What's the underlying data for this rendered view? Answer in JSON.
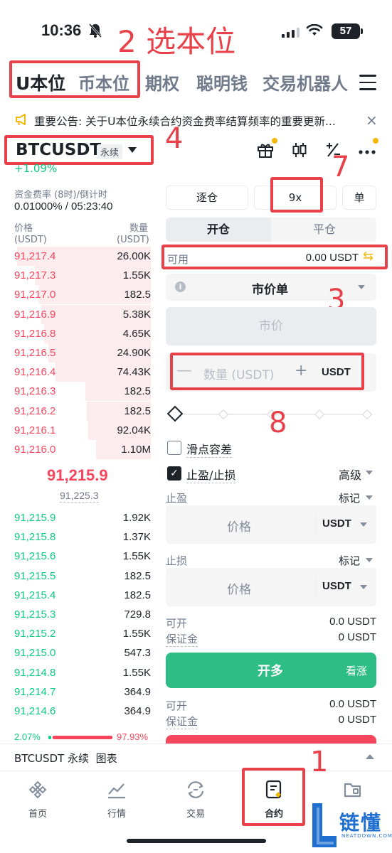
{
  "status": {
    "time": "10:36",
    "battery": "57"
  },
  "annotations": {
    "n1": "1",
    "n2": "2 选本位",
    "n3": "3",
    "n4": "4",
    "n7": "7",
    "n8": "8"
  },
  "top_tabs": {
    "u": "U本位",
    "coin": "币本位",
    "options": "期权",
    "smart": "聪明钱",
    "bot": "交易机器人"
  },
  "notice": {
    "text": "重要公告: 关于U本位永续合约资金费率结算频率的重要更新...",
    "close": "×"
  },
  "symbol": {
    "name": "BTCUSDT",
    "tag": "永续",
    "change": "+1.09%"
  },
  "funding": {
    "label": "资金费率 (8时)/倒计时",
    "value": "0.01000% / 05:23:40"
  },
  "orderbook": {
    "price_header": "价格",
    "price_unit": "(USDT)",
    "qty_header": "数量",
    "qty_unit": "(USDT)",
    "asks": [
      {
        "price": "91,217.4",
        "qty": "26.00K",
        "depth": 0.98
      },
      {
        "price": "91,217.3",
        "qty": "1.55K",
        "depth": 0.85
      },
      {
        "price": "91,217.0",
        "qty": "182.5",
        "depth": 0.82
      },
      {
        "price": "91,216.9",
        "qty": "5.38K",
        "depth": 0.8
      },
      {
        "price": "91,216.8",
        "qty": "4.65K",
        "depth": 0.78
      },
      {
        "price": "91,216.5",
        "qty": "24.90K",
        "depth": 0.75
      },
      {
        "price": "91,216.4",
        "qty": "74.43K",
        "depth": 0.7
      },
      {
        "price": "91,216.3",
        "qty": "182.5",
        "depth": 0.48
      },
      {
        "price": "91,216.2",
        "qty": "182.5",
        "depth": 0.47
      },
      {
        "price": "91,216.1",
        "qty": "92.04K",
        "depth": 0.46
      },
      {
        "price": "91,216.0",
        "qty": "1.10M",
        "depth": 0.4
      }
    ],
    "mid_price": "91,215.9",
    "mark_price": "91,225.3",
    "bids": [
      {
        "price": "91,215.9",
        "qty": "1.92K"
      },
      {
        "price": "91,215.8",
        "qty": "1.37K"
      },
      {
        "price": "91,215.6",
        "qty": "1.55K"
      },
      {
        "price": "91,215.5",
        "qty": "182.5"
      },
      {
        "price": "91,215.4",
        "qty": "182.5"
      },
      {
        "price": "91,215.3",
        "qty": "729.8"
      },
      {
        "price": "91,215.2",
        "qty": "1.55K"
      },
      {
        "price": "91,215.0",
        "qty": "547.3"
      },
      {
        "price": "91,214.8",
        "qty": "1.55K"
      },
      {
        "price": "91,214.7",
        "qty": "364.9"
      },
      {
        "price": "91,214.6",
        "qty": "364.9"
      }
    ],
    "buy_ratio": "2.07%",
    "sell_ratio": "97.93%"
  },
  "trade": {
    "margin_mode": "逐仓",
    "leverage": "9x",
    "position_mode": "单",
    "open_tab": "开仓",
    "close_tab": "平仓",
    "available_label": "可用",
    "available_value": "0.00 USDT",
    "order_type": "市价单",
    "price_placeholder": "市价",
    "qty_minus": "—",
    "qty_placeholder": "数量 (USDT)",
    "qty_plus": "+",
    "qty_unit": "USDT",
    "slippage_label": "滑点容差",
    "tpsl_label": "止盈/止损",
    "advanced": "高级",
    "tp_label": "止盈",
    "tp_mark": "标记",
    "tp_placeholder": "价格",
    "tp_unit": "USDT",
    "sl_label": "止损",
    "sl_mark": "标记",
    "sl_placeholder": "价格",
    "sl_unit": "USDT",
    "buy_can_open_label": "可开",
    "buy_can_open_value": "0.0 USDT",
    "buy_margin_label": "保证金",
    "buy_margin_value": "0 USDT",
    "buy_button": "开多",
    "buy_sub": "看涨",
    "sell_can_open_label": "可开",
    "sell_can_open_value": "0.0 USDT",
    "sell_margin_label": "保证金",
    "sell_margin_value": "0 USDT"
  },
  "chart_bar": {
    "label": "BTCUSDT 永续  图表"
  },
  "nav": {
    "home": "首页",
    "markets": "行情",
    "trade": "交易",
    "futures": "合约"
  },
  "watermark": {
    "text": "链懂",
    "sub": "NEATDOWN.COM"
  }
}
